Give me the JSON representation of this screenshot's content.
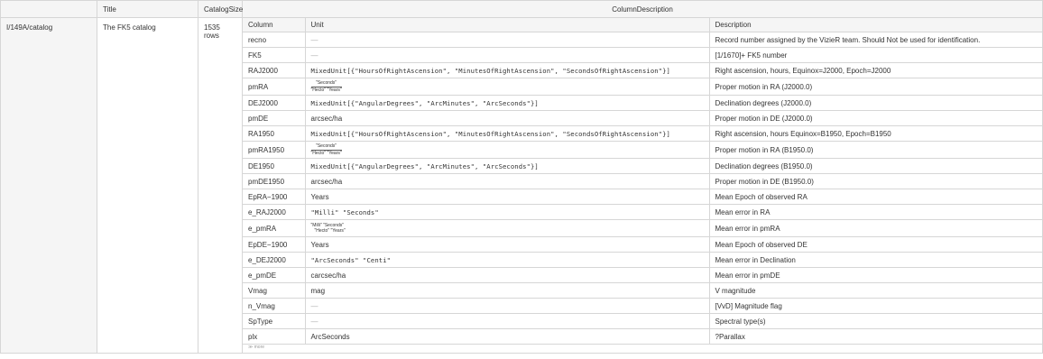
{
  "headers": {
    "title": "Title",
    "catalog_size": "CatalogSize",
    "column_description": "ColumnDescription"
  },
  "row": {
    "key": "I/149A/catalog",
    "title": "The FK5 catalog",
    "catalog_size": "1535 rows"
  },
  "inner_headers": {
    "column": "Column",
    "unit": "Unit",
    "description": "Description"
  },
  "columns": [
    {
      "column": "recno",
      "unit_type": "dash",
      "unit": "—",
      "description": "Record number assigned by the VizieR team. Should Not be used for identification."
    },
    {
      "column": "FK5",
      "unit_type": "dash",
      "unit": "—",
      "description": "[1/1670]+ FK5 number"
    },
    {
      "column": "RAJ2000",
      "unit_type": "mono",
      "unit": "MixedUnit[{\"HoursOfRightAscension\", \"MinutesOfRightAscension\", \"SecondsOfRightAscension\"}]",
      "description": "Right ascension, hours, Equinox=J2000, Epoch=J2000"
    },
    {
      "column": "pmRA",
      "unit_type": "frac",
      "unit_num": "\"Seconds\"",
      "unit_den": "\"Hecto\" \"Years\"",
      "description": "Proper motion in RA (J2000.0)"
    },
    {
      "column": "DEJ2000",
      "unit_type": "mono",
      "unit": "MixedUnit[{\"AngularDegrees\", \"ArcMinutes\", \"ArcSeconds\"}]",
      "description": "Declination degrees (J2000.0)"
    },
    {
      "column": "pmDE",
      "unit_type": "text",
      "unit": "arcsec/ha",
      "description": "Proper motion in DE (J2000.0)"
    },
    {
      "column": "RA1950",
      "unit_type": "mono",
      "unit": "MixedUnit[{\"HoursOfRightAscension\", \"MinutesOfRightAscension\", \"SecondsOfRightAscension\"}]",
      "description": "Right ascension, hours Equinox=B1950, Epoch=B1950"
    },
    {
      "column": "pmRA1950",
      "unit_type": "frac",
      "unit_num": "\"Seconds\"",
      "unit_den": "\"Hecto\" \"Years\"",
      "description": "Proper motion in RA (B1950.0)"
    },
    {
      "column": "DE1950",
      "unit_type": "mono",
      "unit": "MixedUnit[{\"AngularDegrees\", \"ArcMinutes\", \"ArcSeconds\"}]",
      "description": "Declination degrees (B1950.0)"
    },
    {
      "column": "pmDE1950",
      "unit_type": "text",
      "unit": "arcsec/ha",
      "description": "Proper motion in DE (B1950.0)"
    },
    {
      "column": "EpRA−1900",
      "unit_type": "text",
      "unit": "Years",
      "description": "Mean Epoch of observed RA"
    },
    {
      "column": "e_RAJ2000",
      "unit_type": "mono",
      "unit": "\"Milli\" \"Seconds\"",
      "description": "Mean error in RA"
    },
    {
      "column": "e_pmRA",
      "unit_type": "stack",
      "unit_l1": "\"Milli\" \"Seconds\"",
      "unit_l2": "\"Hecto\" \"Years\"",
      "description": "Mean error in pmRA"
    },
    {
      "column": "EpDE−1900",
      "unit_type": "text",
      "unit": "Years",
      "description": "Mean Epoch of observed DE"
    },
    {
      "column": "e_DEJ2000",
      "unit_type": "mono",
      "unit": "\"ArcSeconds\" \"Centi\"",
      "description": "Mean error in Declination"
    },
    {
      "column": "e_pmDE",
      "unit_type": "text",
      "unit": "carcsec/ha",
      "description": "Mean error in pmDE"
    },
    {
      "column": "Vmag",
      "unit_type": "text",
      "unit": "mag",
      "description": "V magnitude"
    },
    {
      "column": "n_Vmag",
      "unit_type": "dash",
      "unit": "—",
      "description": "[VvD] Magnitude flag"
    },
    {
      "column": "SpType",
      "unit_type": "dash",
      "unit": "—",
      "description": "Spectral type(s)"
    },
    {
      "column": "plx",
      "unit_type": "text",
      "unit": "ArcSeconds",
      "description": "?Parallax"
    }
  ],
  "more_label": "≫ more"
}
